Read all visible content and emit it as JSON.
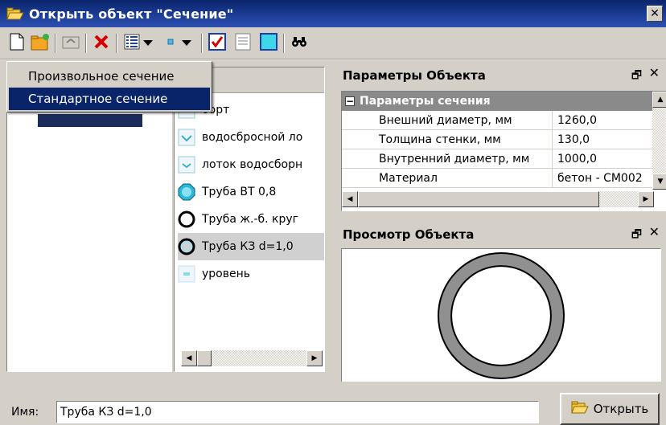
{
  "window": {
    "title": "Открыть объект \"Сечение\"",
    "close_label": "✕"
  },
  "popup_menu": {
    "items": [
      {
        "label": "Произвольное сечение"
      },
      {
        "label": "Стандартное сечение"
      }
    ],
    "highlighted_index": 1
  },
  "tree": {
    "selected_label": ""
  },
  "list": {
    "items": [
      {
        "label": "борт",
        "icon": "section-icon"
      },
      {
        "label": "водосбросной ло",
        "icon": "tray-icon"
      },
      {
        "label": "лоток водосборн",
        "icon": "tray-icon"
      },
      {
        "label": "Труба ВТ 0,8",
        "icon": "pipe-cyan-icon"
      },
      {
        "label": "Труба ж.-б. круг",
        "icon": "pipe-ring-icon"
      },
      {
        "label": "Труба КЗ d=1,0",
        "icon": "pipe-ring-icon"
      },
      {
        "label": "уровень",
        "icon": "level-icon"
      }
    ],
    "selected_index": 5
  },
  "params": {
    "title": "Параметры Объекта",
    "group_label": "Параметры сечения",
    "rows": [
      {
        "label": "Внешний диаметр, мм",
        "value": "1260,0"
      },
      {
        "label": "Толщина стенки, мм",
        "value": "130,0"
      },
      {
        "label": "Внутренний диаметр, мм",
        "value": "1000,0"
      },
      {
        "label": "Материал",
        "value": "бетон - СМ002"
      }
    ]
  },
  "preview": {
    "title": "Просмотр Объекта",
    "outer_diameter_mm": 1260,
    "inner_diameter_mm": 1000,
    "ring_color": "#909090"
  },
  "bottom": {
    "name_label": "Имя:",
    "name_value": "Труба КЗ d=1,0",
    "open_label": "Открыть"
  }
}
